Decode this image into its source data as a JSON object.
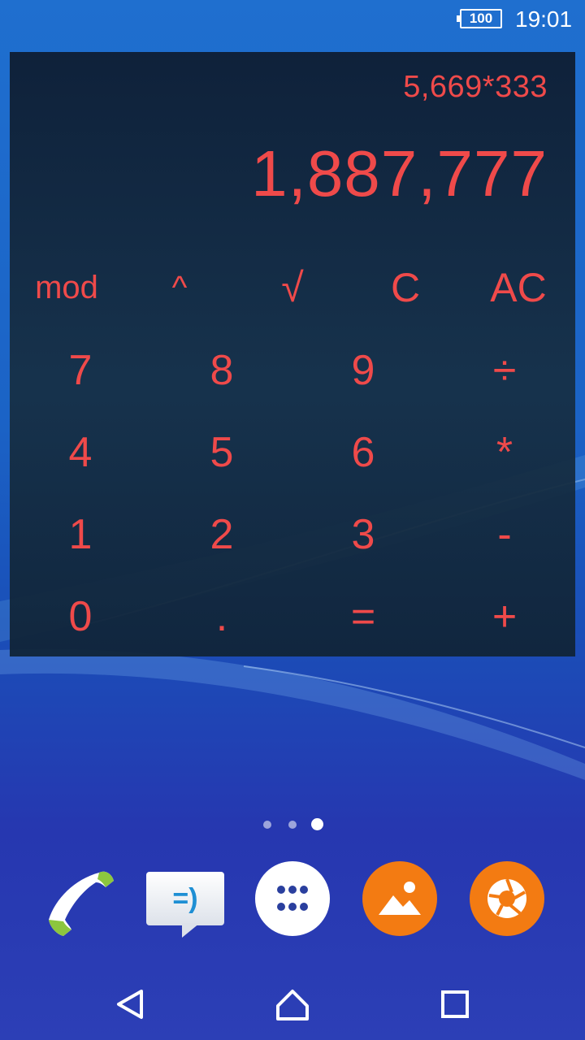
{
  "status_bar": {
    "battery": "100",
    "time": "19:01"
  },
  "calculator": {
    "expression": "5,669*333",
    "result": "1,887,777",
    "function_keys": [
      "mod",
      "^",
      "√",
      "C",
      "AC"
    ],
    "number_rows": [
      [
        "7",
        "8",
        "9",
        "÷"
      ],
      [
        "4",
        "5",
        "6",
        "*"
      ],
      [
        "1",
        "2",
        "3",
        "-"
      ],
      [
        "0",
        ".",
        "=",
        "+"
      ]
    ]
  },
  "home": {
    "page_count": 3,
    "active_page": 3,
    "dock": [
      "phone-icon",
      "messaging-icon",
      "apps-grid-icon",
      "album-icon",
      "camera-icon"
    ],
    "message_icon_glyph": "=)"
  },
  "nav": {
    "buttons": [
      "back-icon",
      "home-icon",
      "recents-icon"
    ]
  },
  "colors": {
    "accent": "#ef4a4a",
    "dock_orange": "#f37b12",
    "phone_green": "#8cc63e"
  }
}
